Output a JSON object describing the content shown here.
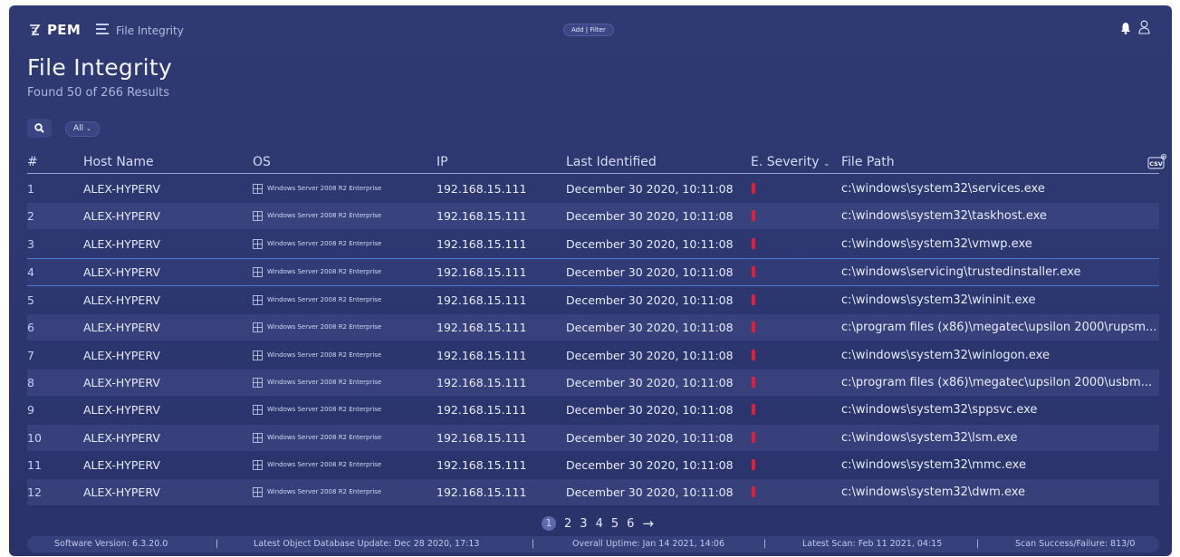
{
  "app": {
    "brand": "PEM",
    "breadcrumb": "File Integrity",
    "add_filter": "Add | Filter"
  },
  "page": {
    "title": "File Integrity",
    "subtitle": "Found 50 of 266 Results",
    "filter_value": "All"
  },
  "table": {
    "headers": {
      "num": "#",
      "host": "Host Name",
      "os": "OS",
      "ip": "IP",
      "last": "Last Identified",
      "severity": "E. Severity",
      "path": "File Path",
      "csv": "CSV"
    },
    "rows": [
      {
        "num": "1",
        "host": "ALEX-HYPERV",
        "os": "Windows Server 2008 R2 Enterprise",
        "ip": "192.168.15.111",
        "date": "December 30 2020, 10:11:08",
        "path": "c:\\windows\\system32\\services.exe"
      },
      {
        "num": "2",
        "host": "ALEX-HYPERV",
        "os": "Windows Server 2008 R2 Enterprise",
        "ip": "192.168.15.111",
        "date": "December 30 2020, 10:11:08",
        "path": "c:\\windows\\system32\\taskhost.exe"
      },
      {
        "num": "3",
        "host": "ALEX-HYPERV",
        "os": "Windows Server 2008 R2 Enterprise",
        "ip": "192.168.15.111",
        "date": "December 30 2020, 10:11:08",
        "path": "c:\\windows\\system32\\vmwp.exe"
      },
      {
        "num": "4",
        "host": "ALEX-HYPERV",
        "os": "Windows Server 2008 R2 Enterprise",
        "ip": "192.168.15.111",
        "date": "December 30 2020, 10:11:08",
        "path": "c:\\windows\\servicing\\trustedinstaller.exe"
      },
      {
        "num": "5",
        "host": "ALEX-HYPERV",
        "os": "Windows Server 2008 R2 Enterprise",
        "ip": "192.168.15.111",
        "date": "December 30 2020, 10:11:08",
        "path": "c:\\windows\\system32\\wininit.exe"
      },
      {
        "num": "6",
        "host": "ALEX-HYPERV",
        "os": "Windows Server 2008 R2 Enterprise",
        "ip": "192.168.15.111",
        "date": "December 30 2020, 10:11:08",
        "path": "c:\\program files (x86)\\megatec\\upsilon 2000\\rupsm..."
      },
      {
        "num": "7",
        "host": "ALEX-HYPERV",
        "os": "Windows Server 2008 R2 Enterprise",
        "ip": "192.168.15.111",
        "date": "December 30 2020, 10:11:08",
        "path": "c:\\windows\\system32\\winlogon.exe"
      },
      {
        "num": "8",
        "host": "ALEX-HYPERV",
        "os": "Windows Server 2008 R2 Enterprise",
        "ip": "192.168.15.111",
        "date": "December 30 2020, 10:11:08",
        "path": "c:\\program files (x86)\\megatec\\upsilon 2000\\usbm..."
      },
      {
        "num": "9",
        "host": "ALEX-HYPERV",
        "os": "Windows Server 2008 R2 Enterprise",
        "ip": "192.168.15.111",
        "date": "December 30 2020, 10:11:08",
        "path": "c:\\windows\\system32\\sppsvc.exe"
      },
      {
        "num": "10",
        "host": "ALEX-HYPERV",
        "os": "Windows Server 2008 R2 Enterprise",
        "ip": "192.168.15.111",
        "date": "December 30 2020, 10:11:08",
        "path": "c:\\windows\\system32\\lsm.exe"
      },
      {
        "num": "11",
        "host": "ALEX-HYPERV",
        "os": "Windows Server 2008 R2 Enterprise",
        "ip": "192.168.15.111",
        "date": "December 30 2020, 10:11:08",
        "path": "c:\\windows\\system32\\mmc.exe"
      },
      {
        "num": "12",
        "host": "ALEX-HYPERV",
        "os": "Windows Server 2008 R2 Enterprise",
        "ip": "192.168.15.111",
        "date": "December 30 2020, 10:11:08",
        "path": "c:\\windows\\system32\\dwm.exe"
      }
    ],
    "selected_row": 4,
    "severity_color": "#e0203a"
  },
  "pagination": {
    "pages": [
      "1",
      "2",
      "3",
      "4",
      "5",
      "6"
    ],
    "current": "1",
    "next": "→"
  },
  "footer": {
    "version": "Software Version: 6.3.20.0",
    "db_update": "Latest Object Database Update: Dec 28 2020, 17:13",
    "uptime": "Overall Uptime: Jan 14 2021, 14:06",
    "last_scan": "Latest Scan: Feb 11 2021, 04:15",
    "scan_rate": "Scan Success/Failure: 813/0",
    "separator": "|"
  },
  "icons": {
    "logo": "pem-logo-icon",
    "menu": "hamburger-menu-icon",
    "bell": "bell-icon",
    "user": "user-icon",
    "search": "search-icon",
    "csv": "csv-export-icon",
    "windows": "windows-icon",
    "sort": "chevron-down-icon"
  }
}
